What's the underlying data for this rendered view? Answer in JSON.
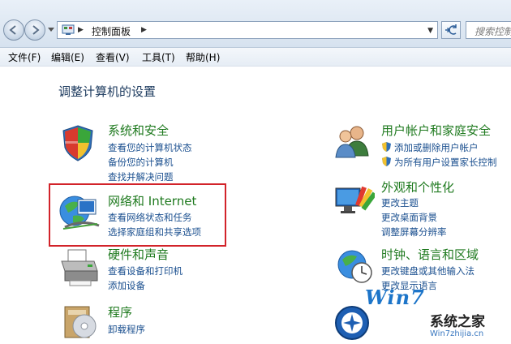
{
  "address_bar": {
    "breadcrumb": [
      "控制面板"
    ],
    "search_placeholder": "搜索控制"
  },
  "menu": [
    "文件(F)",
    "编辑(E)",
    "查看(V)",
    "工具(T)",
    "帮助(H)"
  ],
  "page_title": "调整计算机的设置",
  "left_categories": [
    {
      "title": "系统和安全",
      "icon": "shield-flag-icon",
      "links": [
        "查看您的计算机状态",
        "备份您的计算机",
        "查找并解决问题"
      ]
    },
    {
      "title": "网络和 Internet",
      "icon": "network-globe-icon",
      "links": [
        "查看网络状态和任务",
        "选择家庭组和共享选项"
      ]
    },
    {
      "title": "硬件和声音",
      "icon": "printer-icon",
      "links": [
        "查看设备和打印机",
        "添加设备"
      ]
    },
    {
      "title": "程序",
      "icon": "programs-icon",
      "links": [
        "卸载程序"
      ]
    }
  ],
  "right_categories": [
    {
      "title": "用户帐户和家庭安全",
      "icon": "users-icon",
      "links": [
        "添加或删除用户帐户",
        "为所有用户设置家长控制"
      ]
    },
    {
      "title": "外观和个性化",
      "icon": "monitor-paint-icon",
      "links": [
        "更改主题",
        "更改桌面背景",
        "调整屏幕分辨率"
      ]
    },
    {
      "title": "时钟、语言和区域",
      "icon": "clock-globe-icon",
      "links": [
        "更改键盘或其他输入法",
        "更改显示语言"
      ]
    }
  ],
  "watermark": {
    "brand": "Win7",
    "name": "系统之家",
    "url": "Win7zhijia.cn"
  },
  "colors": {
    "highlight": "#d2232a",
    "category_title": "#1f7a1f",
    "link": "#1a4f8f"
  }
}
